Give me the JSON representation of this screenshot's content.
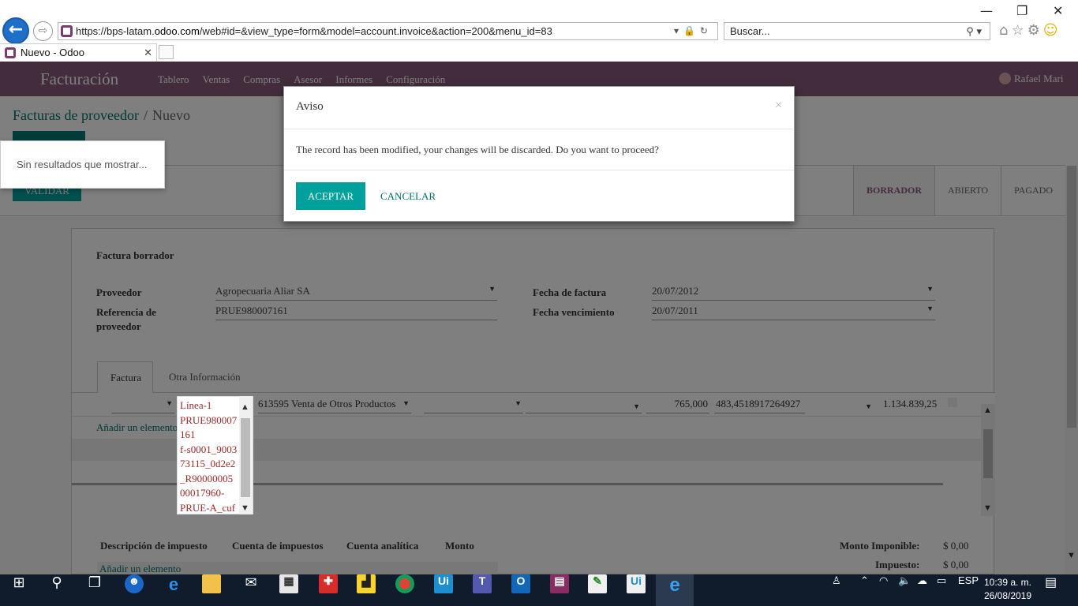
{
  "browser": {
    "url_prefix": "https://bps-latam.",
    "url_domain": "odoo.com",
    "url_rest": "/web#id=&view_type=form&model=account.invoice&action=200&menu_id=83",
    "search_placeholder": "Buscar...",
    "tab_title": "Nuevo - Odoo"
  },
  "navbar": {
    "brand": "Facturación",
    "menu": [
      "Tablero",
      "Ventas",
      "Compras",
      "Asesor",
      "Informes",
      "Configuración"
    ],
    "user": "Rafael Mari"
  },
  "breadcrumb": {
    "parent": "Facturas de proveedor",
    "separator": "/",
    "current": "Nuevo"
  },
  "dropdown_empty": "Sin resultados que mostrar...",
  "statusbar": {
    "validate_label": "VALIDAR",
    "stages": [
      "BORRADOR",
      "ABIERTO",
      "PAGADO"
    ],
    "active_stage": "BORRADOR"
  },
  "form": {
    "title": "Factura borrador",
    "vendor_label": "Proveedor",
    "vendor_value": "Agropecuaria Aliar SA",
    "ref_label_1": "Referencia de",
    "ref_label_2": "proveedor",
    "ref_value": "PRUE980007161",
    "invoice_date_label": "Fecha de factura",
    "invoice_date_value": "20/07/2012",
    "due_date_label": "Fecha vencimiento",
    "due_date_value": "20/07/2011",
    "tabs": [
      "Factura",
      "Otra Información"
    ],
    "line": {
      "account": "613595 Venta de Otros Productos",
      "quantity": "765,000",
      "price": "483,4518917264927",
      "subtotal": "1.134.839,25"
    },
    "add_item": "Añadir un elemento",
    "line_popup": [
      "Línea-1",
      "PRUE980007",
      "161",
      "f-s0001_9003",
      "73115_0d2e2",
      "_R90000005",
      "00017960-",
      "PRUE-A_cuf"
    ],
    "tax_headers": [
      "Descripción de impuesto",
      "Cuenta de impuestos",
      "Cuenta analítica",
      "Monto"
    ],
    "totals": {
      "untaxed_label": "Monto Imponible:",
      "untaxed_value": "$ 0,00",
      "tax_label": "Impuesto:",
      "tax_value": "$ 0,00"
    }
  },
  "modal": {
    "title": "Aviso",
    "close": "×",
    "body": "The record has been modified, your changes will be discarded. Do you want to proceed?",
    "ok_label": "ACEPTAR",
    "cancel_label": "CANCELAR"
  },
  "taskbar": {
    "language": "ESP",
    "time": "10:39 a. m.",
    "date": "26/08/2019"
  },
  "colors": {
    "odoo_purple": "#875a7b",
    "odoo_teal": "#00a09d",
    "link_teal": "#00716b",
    "taskbar": "#101c2c"
  }
}
